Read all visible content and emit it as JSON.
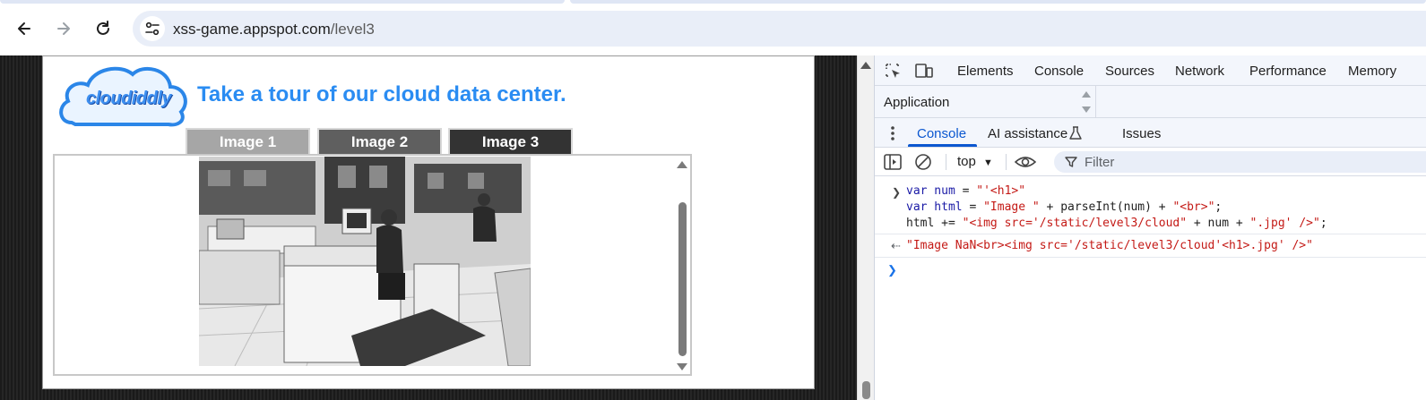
{
  "browser": {
    "url_host": "xss-game.appspot.com",
    "url_path": "/level3",
    "back_label": "Back",
    "forward_label": "Forward",
    "reload_label": "Reload"
  },
  "page": {
    "logo_text": "cloudiddly",
    "headline": "Take a tour of our cloud data center.",
    "tabs": [
      {
        "label": "Image 1",
        "color": "#a6a6a6"
      },
      {
        "label": "Image 2",
        "color": "#5f5f5f"
      },
      {
        "label": "Image 3",
        "color": "#333333"
      }
    ]
  },
  "devtools": {
    "tabs": [
      "Elements",
      "Console",
      "Sources",
      "Network",
      "Performance",
      "Memory"
    ],
    "second_row_tab": "Application",
    "drawer_tabs": [
      "Console",
      "AI assistance",
      "Issues"
    ],
    "context": "top",
    "filter_placeholder": "Filter",
    "console_input": {
      "line1": {
        "kw": "var",
        "name": " num",
        "op": " = ",
        "str": "\"'<h1>\""
      },
      "line2": {
        "kw": "var",
        "name": " html",
        "op": " = ",
        "s1": "\"Image \"",
        "mid": " + parseInt(num) + ",
        "s2": "\"<br>\"",
        "end": ";"
      },
      "line3": {
        "pre": "html += ",
        "s1": "\"<img src='/static/level3/cloud\"",
        "mid": " + num + ",
        "s2": "\".jpg' />\"",
        "end": ";"
      }
    },
    "console_result": "\"Image NaN<br><img src='/static/level3/cloud'<h1>.jpg' />\""
  }
}
